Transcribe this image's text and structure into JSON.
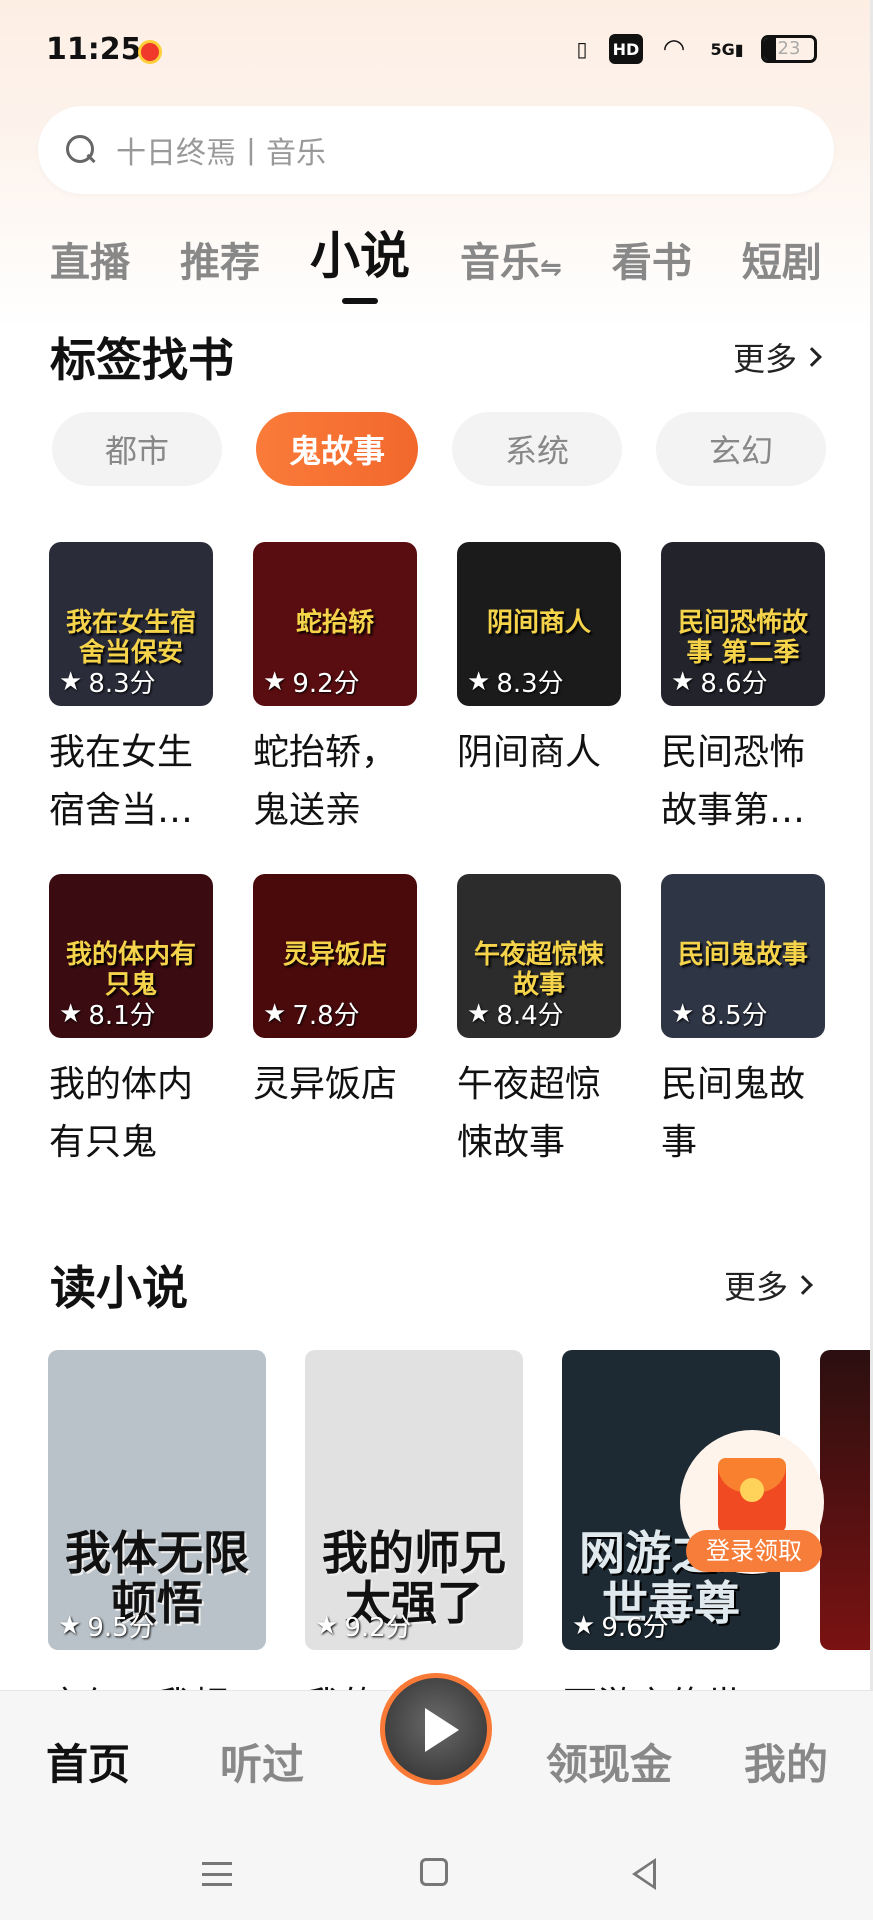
{
  "status_bar": {
    "time": "11:25",
    "hd_label": "HD",
    "signal_label": "5G",
    "battery_level": 23,
    "battery_text": "23"
  },
  "search": {
    "placeholder": "十日终焉丨音乐"
  },
  "tabs": [
    {
      "label": "直播",
      "active": false
    },
    {
      "label": "推荐",
      "active": false
    },
    {
      "label": "小说",
      "active": true
    },
    {
      "label": "音乐",
      "active": false,
      "suffix": "⇋"
    },
    {
      "label": "看书",
      "active": false
    },
    {
      "label": "短剧",
      "active": false
    }
  ],
  "tag_section": {
    "title": "标签找书",
    "more_label": "更多",
    "chips": [
      "都市",
      "鬼故事",
      "系统",
      "玄幻"
    ],
    "active_chip": "鬼故事",
    "books_row1": [
      {
        "cover_text": "我在女生宿舍当保安",
        "rating": "8.3分",
        "name": "我在女生宿舍当…",
        "bg": "#2a2c3a"
      },
      {
        "cover_text": "蛇抬轿",
        "rating": "9.2分",
        "name": "蛇抬轿，鬼送亲",
        "bg": "#5a0d10"
      },
      {
        "cover_text": "阴间商人",
        "rating": "8.3分",
        "name": "阴间商人",
        "bg": "#1b1b1b"
      },
      {
        "cover_text": "民间恐怖故事 第二季",
        "rating": "8.6分",
        "name": "民间恐怖故事第…",
        "bg": "#23232c"
      }
    ],
    "books_row2": [
      {
        "cover_text": "我的体内有只鬼",
        "rating": "8.1分",
        "name": "我的体内有只鬼",
        "bg": "#3a0b10"
      },
      {
        "cover_text": "灵异饭店",
        "rating": "7.8分",
        "name": "灵异饭店",
        "bg": "#4a0a0c"
      },
      {
        "cover_text": "午夜超惊悚故事",
        "rating": "8.4分",
        "name": "午夜超惊悚故事",
        "bg": "#2c2c2c"
      },
      {
        "cover_text": "民间鬼故事",
        "rating": "8.5分",
        "name": "民间鬼故事",
        "bg": "#2e3545"
      }
    ]
  },
  "read_section": {
    "title": "读小说",
    "more_label": "更多",
    "books": [
      {
        "cover_text": "我体无限顿悟",
        "rating": "9.5分",
        "name": "玄幻：我顿…",
        "bg": "#b9c2c9"
      },
      {
        "cover_text": "我的师兄太强了",
        "rating": "9.2分",
        "name": "我的…",
        "bg": "#e1e1e1"
      },
      {
        "cover_text": "网游之绝世毒尊",
        "rating": "9.6分",
        "name": "网游之绝世…",
        "bg": "#1d2a33"
      }
    ]
  },
  "floating_promo": {
    "label": "登录领取"
  },
  "bottom_nav": {
    "items": [
      "首页",
      "听过",
      "领现金",
      "我的"
    ],
    "active": "首页"
  }
}
